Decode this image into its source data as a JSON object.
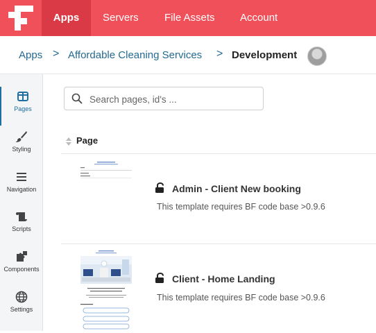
{
  "topnav": {
    "logo_icon": "grid-logo",
    "items": [
      {
        "label": "Apps",
        "active": true
      },
      {
        "label": "Servers",
        "active": false
      },
      {
        "label": "File Assets",
        "active": false
      },
      {
        "label": "Account",
        "active": false
      }
    ]
  },
  "breadcrumb": {
    "items": [
      "Apps",
      "Affordable Cleaning Services",
      "Development"
    ],
    "separator": ">"
  },
  "sidebar": {
    "items": [
      {
        "label": "Pages",
        "icon": "pages-icon",
        "active": true
      },
      {
        "label": "Styling",
        "icon": "brush-icon",
        "active": false
      },
      {
        "label": "Navigation",
        "icon": "menu-icon",
        "active": false
      },
      {
        "label": "Scripts",
        "icon": "scroll-icon",
        "active": false
      },
      {
        "label": "Components",
        "icon": "puzzle-icon",
        "active": false
      },
      {
        "label": "Settings",
        "icon": "globe-icon",
        "active": false
      }
    ]
  },
  "search": {
    "placeholder": "Search pages, id's ...",
    "value": ""
  },
  "table": {
    "column_header": "Page",
    "rows": [
      {
        "title": "Admin - Client New booking",
        "subtitle": "This template requires BF code base >0.9.6",
        "locked": true
      },
      {
        "title": "Client - Home Landing",
        "subtitle": "This template requires BF code base >0.9.6",
        "locked": true
      }
    ]
  },
  "colors": {
    "brand": "#f0505a",
    "brand_active": "#d93a45",
    "link": "#236a92"
  }
}
